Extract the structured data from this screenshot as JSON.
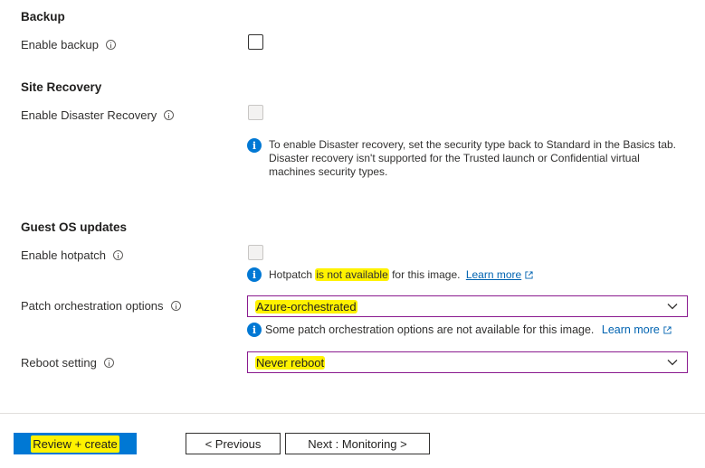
{
  "backup": {
    "title": "Backup",
    "enable_label": "Enable backup"
  },
  "site_recovery": {
    "title": "Site Recovery",
    "enable_label": "Enable Disaster Recovery",
    "info_line1": "To enable Disaster recovery, set the security type back to Standard in the Basics tab.",
    "info_line2": "Disaster recovery isn't supported for the Trusted launch or Confidential virtual",
    "info_line3": "machines security types."
  },
  "guest_os": {
    "title": "Guest OS updates",
    "hotpatch_label": "Enable hotpatch",
    "hotpatch_info_prefix": "Hotpatch ",
    "hotpatch_info_highlight": "is not available",
    "hotpatch_info_suffix": " for this image.",
    "hotpatch_learn_more": "Learn more",
    "patch_label": "Patch orchestration options",
    "patch_value": "Azure-orchestrated",
    "patch_info": "Some patch orchestration options are not available for this image.",
    "patch_learn_more": "Learn more",
    "reboot_label": "Reboot setting",
    "reboot_value": "Never reboot"
  },
  "footer": {
    "review_create": "Review + create",
    "previous": "< Previous",
    "next": "Next : Monitoring >"
  },
  "colors": {
    "accent": "#0078d4",
    "highlight": "#fff200",
    "dropdown_border": "#8a1a8f",
    "link": "#0063b1"
  },
  "icons": {
    "info": "info-icon",
    "info_filled": "info-filled-icon",
    "external_link": "external-link-icon",
    "chevron": "chevron-down-icon"
  }
}
